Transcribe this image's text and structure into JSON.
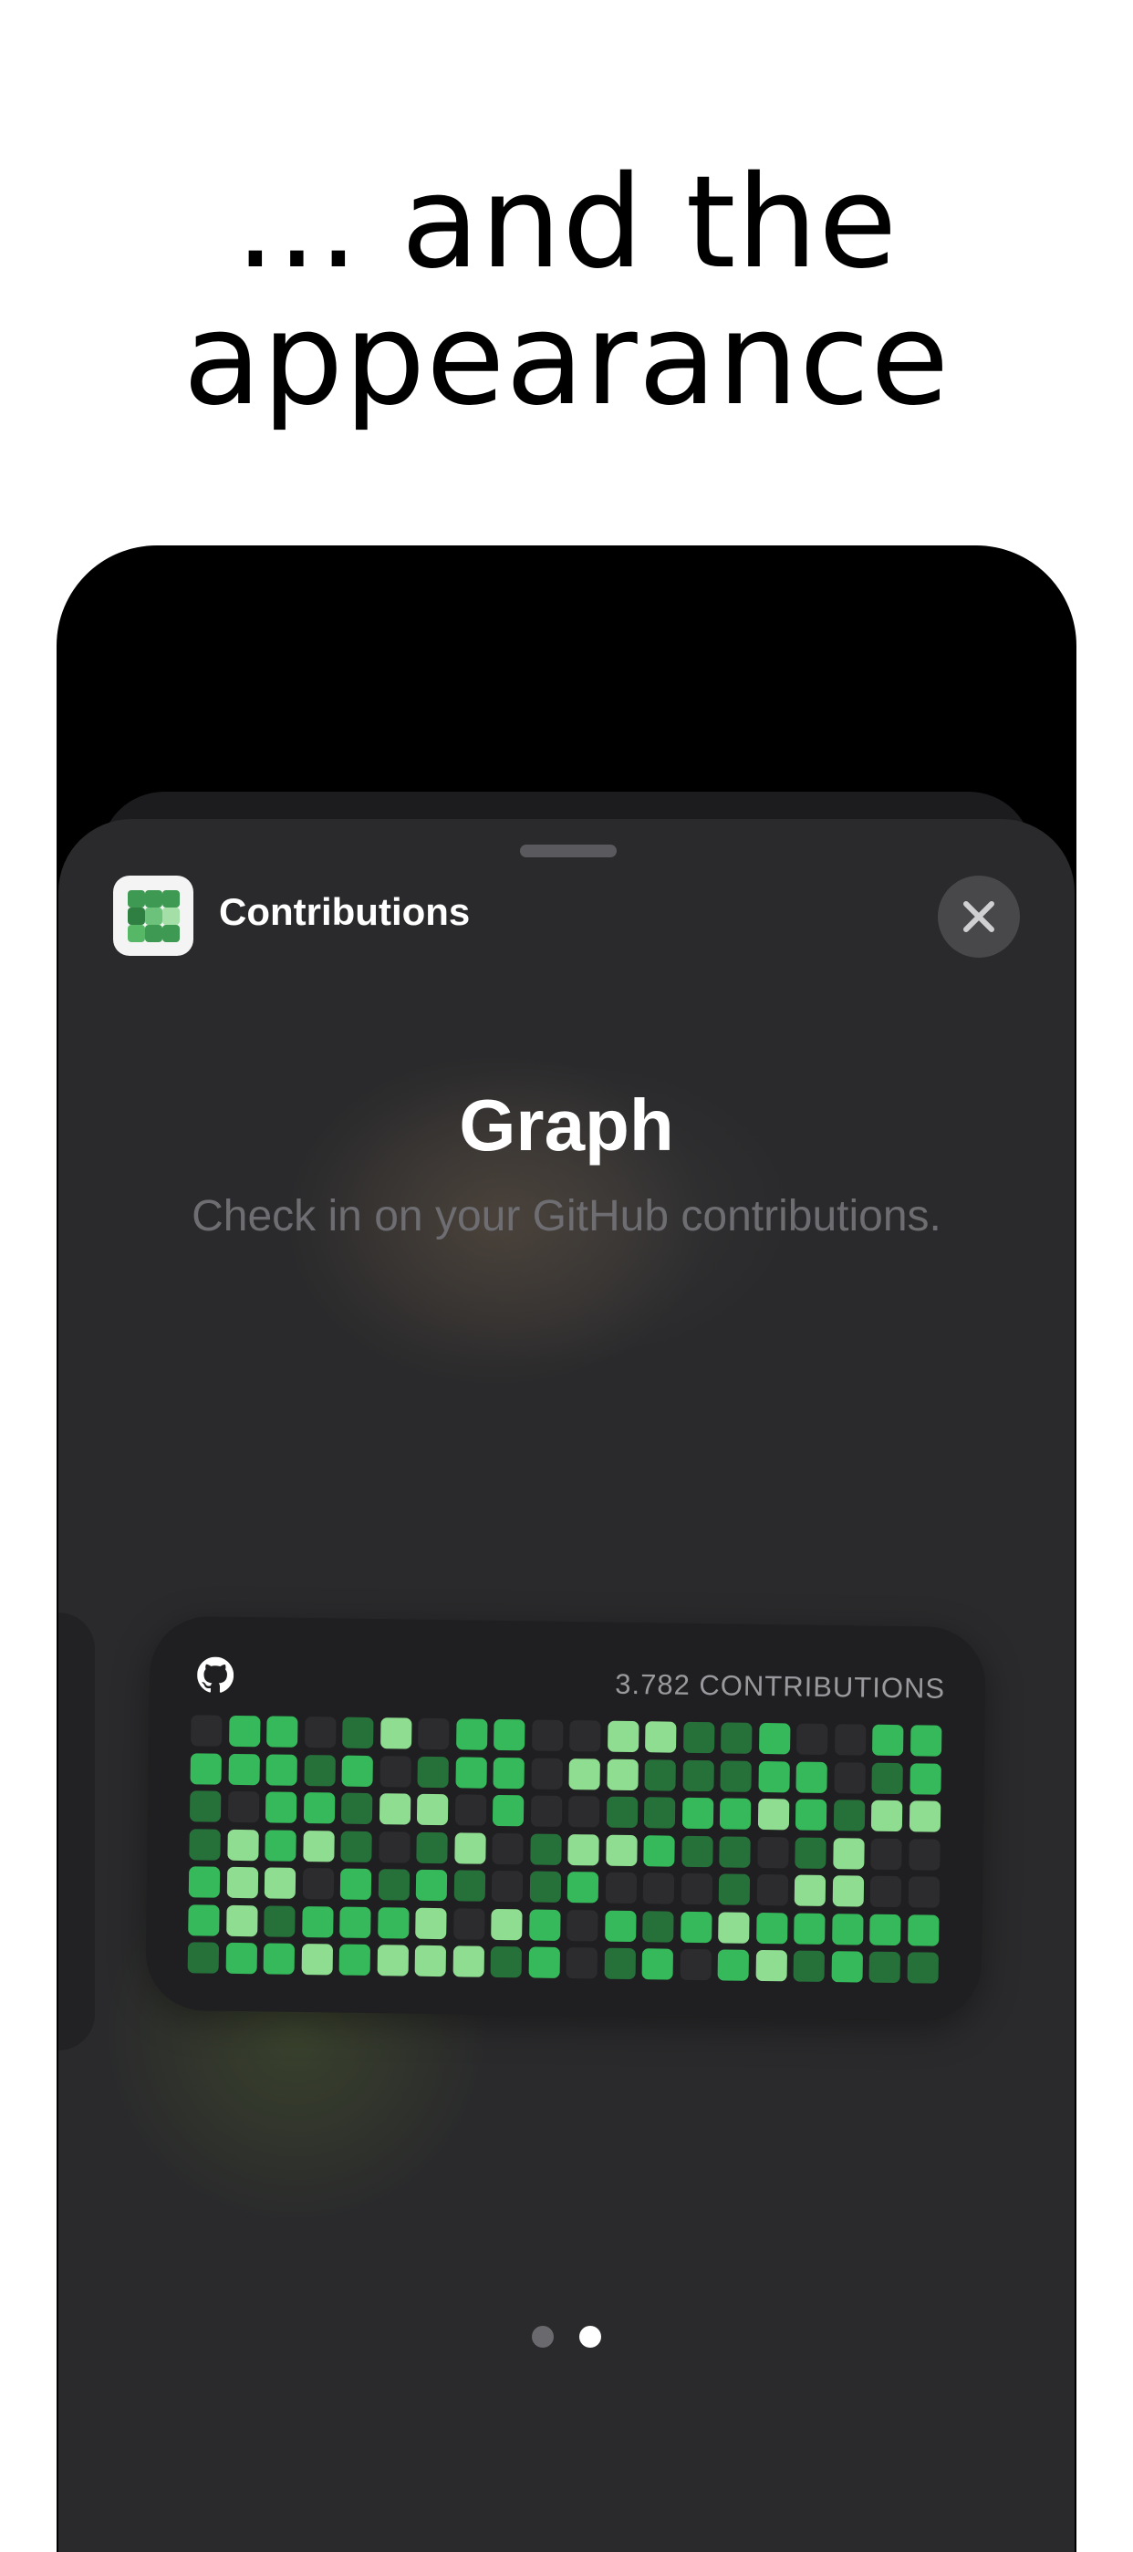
{
  "headline": {
    "line1": "... and the",
    "line2": "appearance"
  },
  "sheet": {
    "app_name": "Contributions",
    "close_icon": "close-icon",
    "widget_title": "Graph",
    "widget_description": "Check in on your GitHub contributions."
  },
  "widget": {
    "logo_icon": "github-icon",
    "contributions_label": "3.782 CONTRIBUTIONS",
    "levels": [
      [
        0,
        3,
        3,
        0,
        2,
        4,
        0,
        3,
        3,
        0,
        0,
        4,
        4,
        2,
        2,
        3,
        0,
        0,
        3,
        3
      ],
      [
        3,
        3,
        3,
        2,
        3,
        0,
        2,
        3,
        3,
        0,
        4,
        4,
        2,
        2,
        2,
        3,
        3,
        0,
        2,
        3
      ],
      [
        2,
        0,
        3,
        3,
        2,
        4,
        4,
        0,
        3,
        0,
        0,
        2,
        2,
        3,
        3,
        4,
        3,
        2,
        4,
        4
      ],
      [
        2,
        4,
        3,
        4,
        2,
        0,
        2,
        4,
        0,
        2,
        4,
        4,
        3,
        2,
        2,
        0,
        2,
        4,
        0,
        0
      ],
      [
        3,
        4,
        4,
        0,
        3,
        2,
        3,
        2,
        0,
        2,
        3,
        0,
        0,
        0,
        2,
        0,
        4,
        4,
        0,
        0
      ],
      [
        3,
        4,
        2,
        3,
        3,
        3,
        4,
        0,
        4,
        3,
        0,
        3,
        2,
        3,
        4,
        3,
        3,
        3,
        3,
        3
      ],
      [
        2,
        3,
        3,
        4,
        3,
        4,
        4,
        4,
        2,
        3,
        0,
        2,
        3,
        0,
        3,
        4,
        2,
        3,
        2,
        2
      ]
    ],
    "level_colors": [
      "#2c2c2f",
      "#1f6b35",
      "#26703a",
      "#35b95a",
      "#8fdd90"
    ]
  },
  "pager": {
    "pages": 2,
    "active": 1
  }
}
